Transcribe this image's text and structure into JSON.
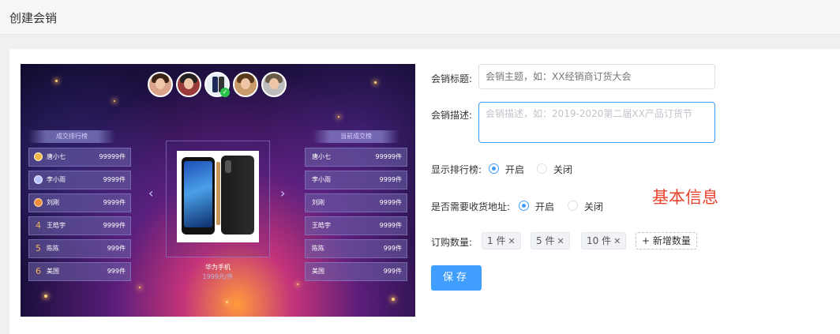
{
  "header": {
    "title": "创建会销"
  },
  "preview": {
    "left_board_title": "成交排行榜",
    "right_board_title": "当前成交榜",
    "left_rows": [
      {
        "name": "唐小七",
        "value": "99999件"
      },
      {
        "name": "李小雨",
        "value": "9999件"
      },
      {
        "name": "刘刚",
        "value": "9999件"
      },
      {
        "rank": "4",
        "name": "王皓宇",
        "value": "9999件"
      },
      {
        "rank": "5",
        "name": "陈陈",
        "value": "999件"
      },
      {
        "rank": "6",
        "name": "美国",
        "value": "999件"
      }
    ],
    "right_rows": [
      {
        "name": "唐小七",
        "value": "99999件"
      },
      {
        "name": "李小雨",
        "value": "9999件"
      },
      {
        "name": "刘刚",
        "value": "9999件"
      },
      {
        "name": "王皓宇",
        "value": "9999件"
      },
      {
        "name": "陈陈",
        "value": "999件"
      },
      {
        "name": "美国",
        "value": "999件"
      }
    ],
    "product_name": "华为手机",
    "product_price": "1999元/件",
    "prev_arrow": "‹",
    "next_arrow": "›",
    "check_mark": "✓"
  },
  "form": {
    "title_label": "会销标题:",
    "title_placeholder": "会销主题，如：XX经销商订货大会",
    "desc_label": "会销描述:",
    "desc_placeholder": "会销描述，如：2019-2020第二届XX产品订货节",
    "rank_label": "显示排行榜:",
    "rank_on": "开启",
    "rank_off": "关闭",
    "address_label": "是否需要收货地址:",
    "address_on": "开启",
    "address_off": "关闭",
    "qty_label": "订购数量:",
    "qty_tags": [
      "1 件",
      "5 件",
      "10 件"
    ],
    "tag_close": "✕",
    "add_qty": "+ 新增数量",
    "save": "保存"
  },
  "annotation": "基本信息"
}
